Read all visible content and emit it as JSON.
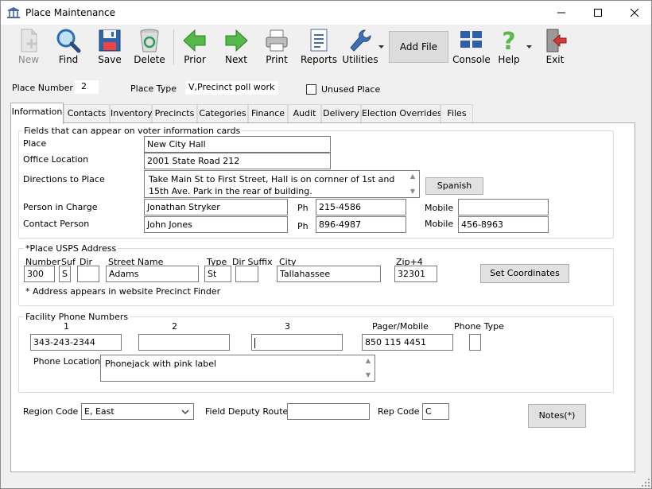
{
  "window": {
    "title": "Place Maintenance"
  },
  "toolbar": {
    "new": "New",
    "find": "Find",
    "save": "Save",
    "delete": "Delete",
    "prior": "Prior",
    "next": "Next",
    "print": "Print",
    "reports": "Reports",
    "utilities": "Utilities",
    "add_file": "Add File",
    "console": "Console",
    "help": "Help",
    "exit": "Exit"
  },
  "header": {
    "place_number_label": "Place Number",
    "place_number": "2",
    "place_type_label": "Place Type",
    "place_type": "V,Precinct poll work",
    "unused_place_label": "Unused Place"
  },
  "tabs": [
    "Information",
    "Contacts",
    "Inventory",
    "Precincts",
    "Categories",
    "Finance",
    "Audit",
    "Delivery",
    "Election Overrides",
    "Files"
  ],
  "voter_info": {
    "title": "Fields that can appear on voter information cards",
    "place_label": "Place",
    "place": "New City Hall",
    "office_location_label": "Office Location",
    "office_location": "2001 State Road 212",
    "directions_label": "Directions to Place",
    "directions": "Take Main St to First Street, Hall is on cornner of 1st and 15th Ave. Park in the rear of building.",
    "spanish_button": "Spanish",
    "person_in_charge_label": "Person in Charge",
    "person_in_charge": "Jonathan Stryker",
    "contact_person_label": "Contact Person",
    "contact_person": "John Jones",
    "ph_label": "Ph",
    "person_phone": "215-4586",
    "contact_phone": "896-4987",
    "mobile_label": "Mobile",
    "person_mobile": "",
    "contact_mobile": "456-8963"
  },
  "usps": {
    "title": "*Place USPS Address",
    "number_label": "Number",
    "suf_label": "Suf",
    "dir_label": "Dir",
    "street_label": "Street Name",
    "type_label": "Type",
    "dir_suffix_label": "Dir Suffix",
    "city_label": "City",
    "zip_label": "Zip+4",
    "number": "300",
    "suf": "S",
    "dir": "",
    "street": "Adams",
    "type": "St",
    "dir_suffix": "",
    "city": "Tallahassee",
    "zip": "32301",
    "set_coordinates": "Set Coordinates",
    "note": "* Address appears in website Precinct Finder"
  },
  "facility": {
    "title": "Facility Phone Numbers",
    "col1": "1",
    "col2": "2",
    "col3": "3",
    "pager_label": "Pager/Mobile",
    "phone_type_label": "Phone Type",
    "phone1": "343-243-2344",
    "phone2": "",
    "phone3": "",
    "pager": "850 115 4451",
    "phone_type": "",
    "phone_location_label": "Phone Location",
    "phone_location": "Phonejack with pink label"
  },
  "footer": {
    "region_code_label": "Region Code",
    "region_code": "E, East",
    "field_deputy_label": "Field Deputy Route",
    "field_deputy": "",
    "rep_code_label": "Rep Code",
    "rep_code": "C",
    "notes_button": "Notes(*)"
  }
}
